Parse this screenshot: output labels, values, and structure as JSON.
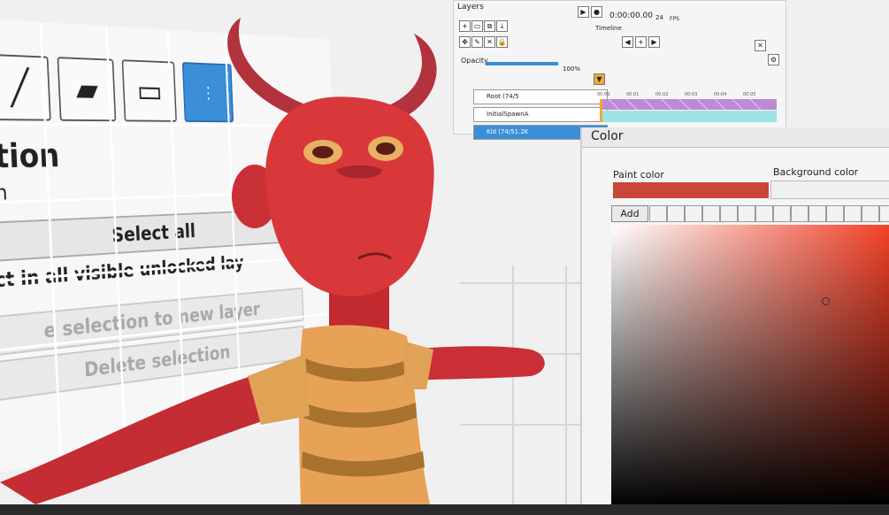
{
  "selection_panel": {
    "heading": "ction",
    "subheading": "ion",
    "select_all": "Select all",
    "select_all_layers": "ect in all visible unlocked lay",
    "selection_to_new_layer": "e selection to new layer",
    "delete_selection": "Delete selection",
    "tools": [
      "brush-tool-icon",
      "fill-tool-icon",
      "eraser-tool-icon",
      "select-tool-icon"
    ]
  },
  "layers_panel": {
    "title": "Layers",
    "time": "0:00:00.00",
    "fps_value": "24",
    "fps_label": "FPS",
    "timeline_label": "Timeline",
    "opacity_label": "Opacity",
    "opacity_value": "100%",
    "opacity_level": 1.0,
    "layers": [
      {
        "name": "Root (74/5",
        "selected": false
      },
      {
        "name": "InitialSpawnA",
        "selected": false
      },
      {
        "name": "Kid (74/51.2K",
        "selected": true
      }
    ],
    "ruler": [
      "00:00",
      "00:01",
      "00:02",
      "00:03",
      "00:04",
      "00:05"
    ]
  },
  "color_panel": {
    "title": "Color",
    "paint_label": "Paint color",
    "background_label": "Background color",
    "add_label": "Add",
    "paint_color": "#c8473a",
    "background_color": "#f0f0f0",
    "hue_color": "#f23a1f"
  },
  "colors": {
    "skin": "#d9383a",
    "skin_shadow": "#a8262d",
    "horn": "#b2323d",
    "shirt_light": "#e8a257",
    "shirt_dark": "#a8722f",
    "eye": "#e8b060",
    "select_blue": "#3a8fd8"
  }
}
